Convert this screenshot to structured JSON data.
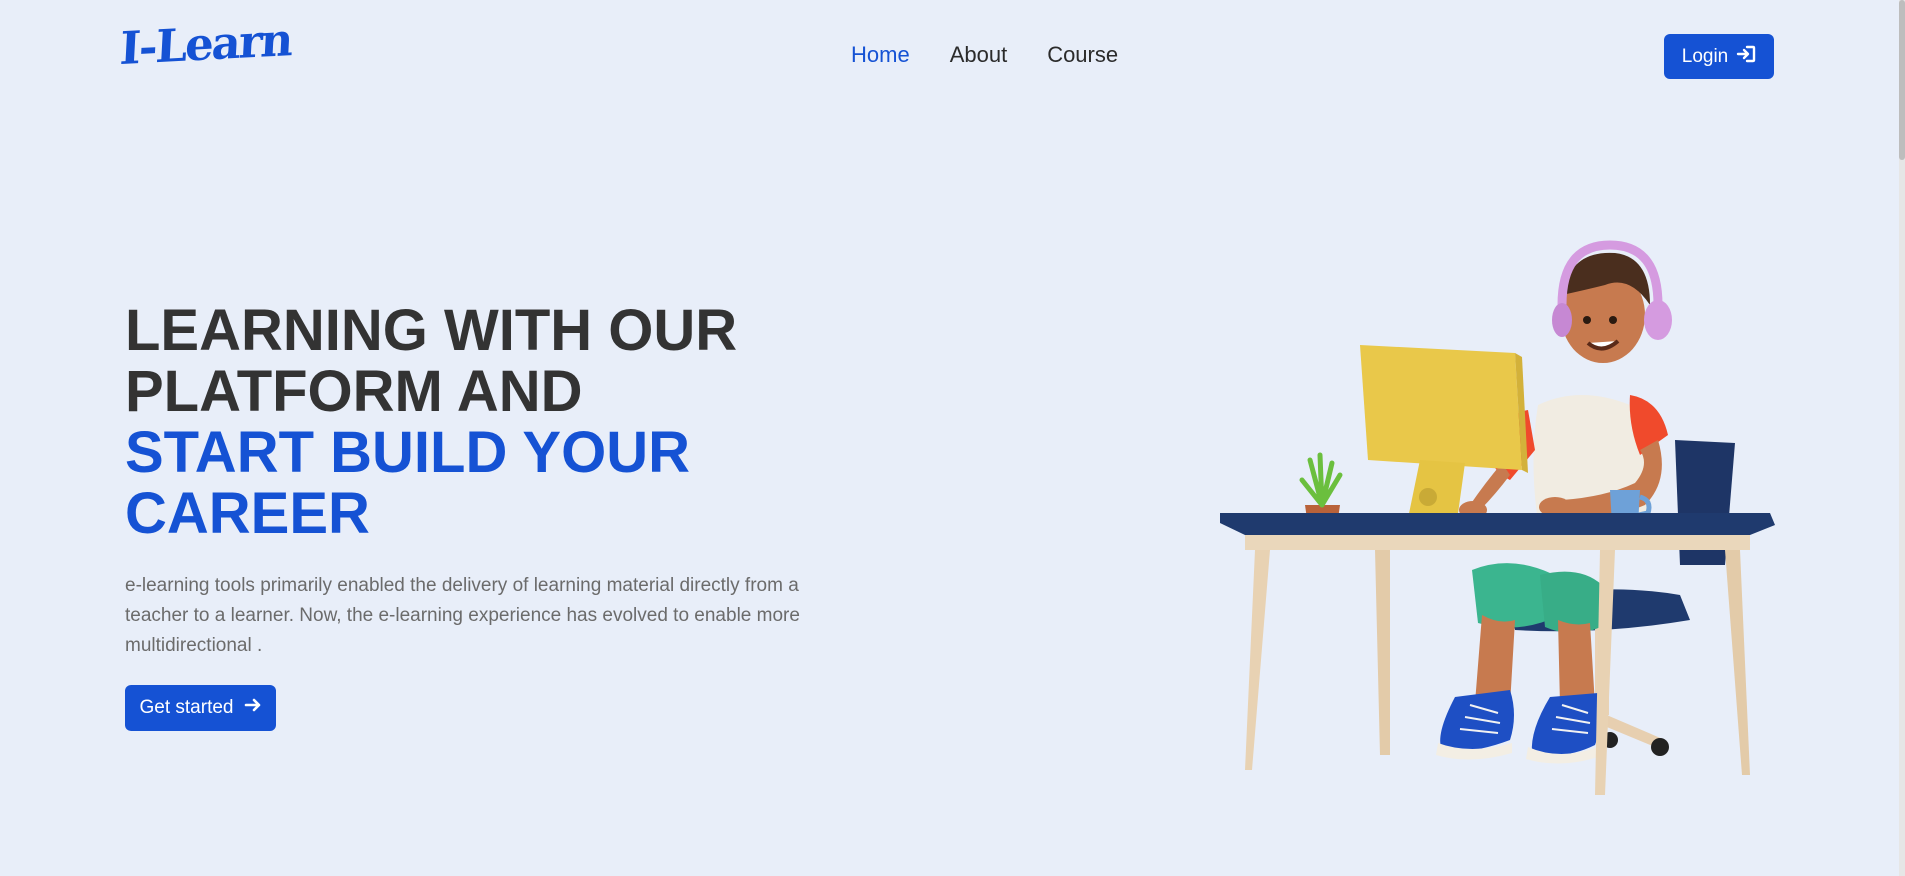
{
  "brand": {
    "logo_text": "I-Learn",
    "accent_color": "#1552d4"
  },
  "nav": {
    "links": [
      {
        "label": "Home",
        "active": true
      },
      {
        "label": "About",
        "active": false
      },
      {
        "label": "Course",
        "active": false
      }
    ],
    "login_label": "Login",
    "login_icon": "sign-in-icon"
  },
  "hero": {
    "headline_line1": "LEARNING WITH OUR",
    "headline_line2": "PLATFORM AND",
    "headline_line3": "START BUILD YOUR",
    "headline_line4": "CAREER",
    "description": "e-learning tools primarily enabled the delivery of learning material directly from a teacher to a learner. Now, the e-learning experience has evolved to enable more multidirectional .",
    "cta_label": "Get started",
    "cta_icon": "arrow-right-icon"
  },
  "illustration": {
    "subject": "person-at-desk-illustration"
  },
  "colors": {
    "background": "#e8eef9",
    "heading_dark": "#333333",
    "body_text": "#6b6b6b"
  }
}
